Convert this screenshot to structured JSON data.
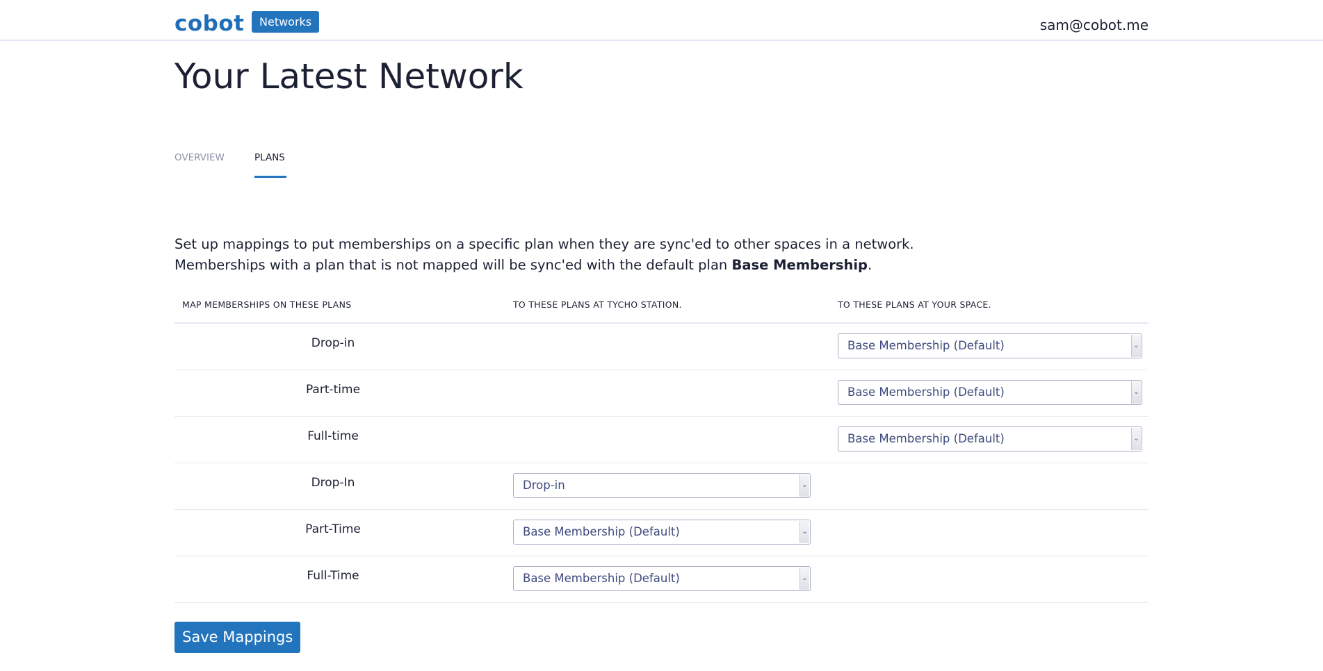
{
  "header": {
    "logo": "cobot",
    "networks_label": "Networks",
    "user_email": "sam@cobot.me"
  },
  "page": {
    "title": "Your Latest Network"
  },
  "tabs": [
    {
      "label": "OVERVIEW",
      "active": false
    },
    {
      "label": "PLANS",
      "active": true
    }
  ],
  "description": {
    "line1": "Set up mappings to put memberships on a specific plan when they are sync'ed to other spaces in a network.",
    "line2_prefix": "Memberships with a plan that is not mapped will be sync'ed with the default plan ",
    "line2_bold": "Base Membership",
    "line2_suffix": "."
  },
  "table": {
    "headers": [
      "MAP MEMBERSHIPS ON THESE PLANS",
      "TO THESE PLANS AT TYCHO STATION.",
      "TO THESE PLANS AT YOUR SPACE."
    ],
    "rows": [
      {
        "plan": "Drop-in",
        "tycho": null,
        "yours": "Base Membership (Default)"
      },
      {
        "plan": "Part-time",
        "tycho": null,
        "yours": "Base Membership (Default)"
      },
      {
        "plan": "Full-time",
        "tycho": null,
        "yours": "Base Membership (Default)"
      },
      {
        "plan": "Drop-In",
        "tycho": "Drop-in",
        "yours": null
      },
      {
        "plan": "Part-Time",
        "tycho": "Base Membership (Default)",
        "yours": null
      },
      {
        "plan": "Full-Time",
        "tycho": "Base Membership (Default)",
        "yours": null
      }
    ]
  },
  "actions": {
    "save_label": "Save Mappings"
  },
  "colors": {
    "accent": "#2274bd",
    "text": "#1b2033",
    "muted": "#8d93a8"
  }
}
